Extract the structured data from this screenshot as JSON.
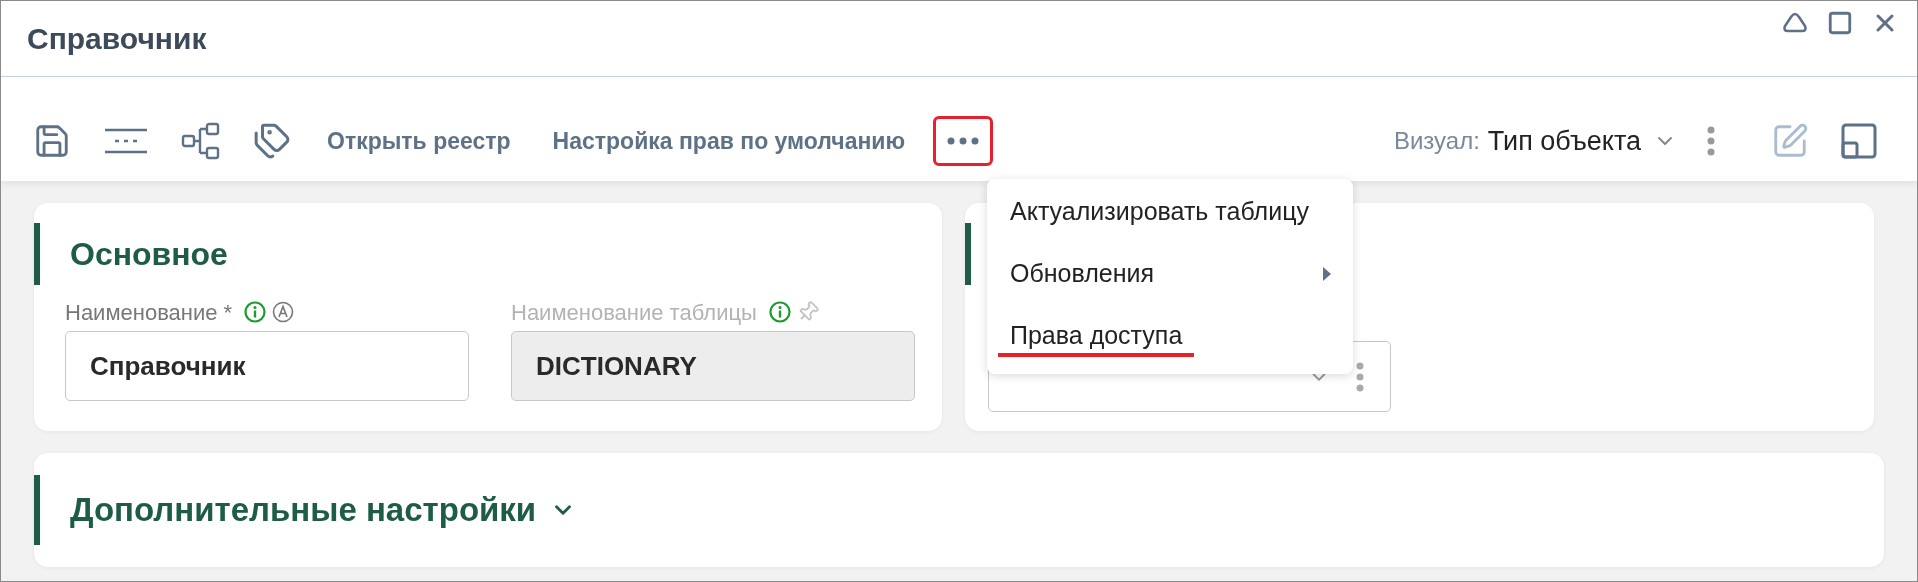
{
  "window": {
    "title": "Справочник"
  },
  "toolbar": {
    "actions": [
      {
        "label": "Открыть реестр"
      },
      {
        "label": "Настройка прав по умолчанию"
      }
    ],
    "more_highlighted": true,
    "visual": {
      "label": "Визуал:",
      "value": "Тип объекта"
    }
  },
  "menu": {
    "items": [
      {
        "label": "Актуализировать таблицу",
        "kind": "action",
        "underlined": false
      },
      {
        "label": "Обновления",
        "kind": "submenu",
        "underlined": false
      },
      {
        "label": "Права доступа",
        "kind": "action",
        "underlined": true
      }
    ]
  },
  "main_section": {
    "title": "Основное",
    "fields": [
      {
        "label": "Наименование *",
        "value": "Справочник",
        "disabled": false,
        "kind": "auto"
      },
      {
        "label": "Наименование таблицы",
        "value": "DICTIONARY",
        "disabled": true,
        "kind": "pinned"
      }
    ]
  },
  "second_section": {
    "select_present": true
  },
  "extra_section": {
    "title": "Дополнительные настройки",
    "expanded": false
  }
}
